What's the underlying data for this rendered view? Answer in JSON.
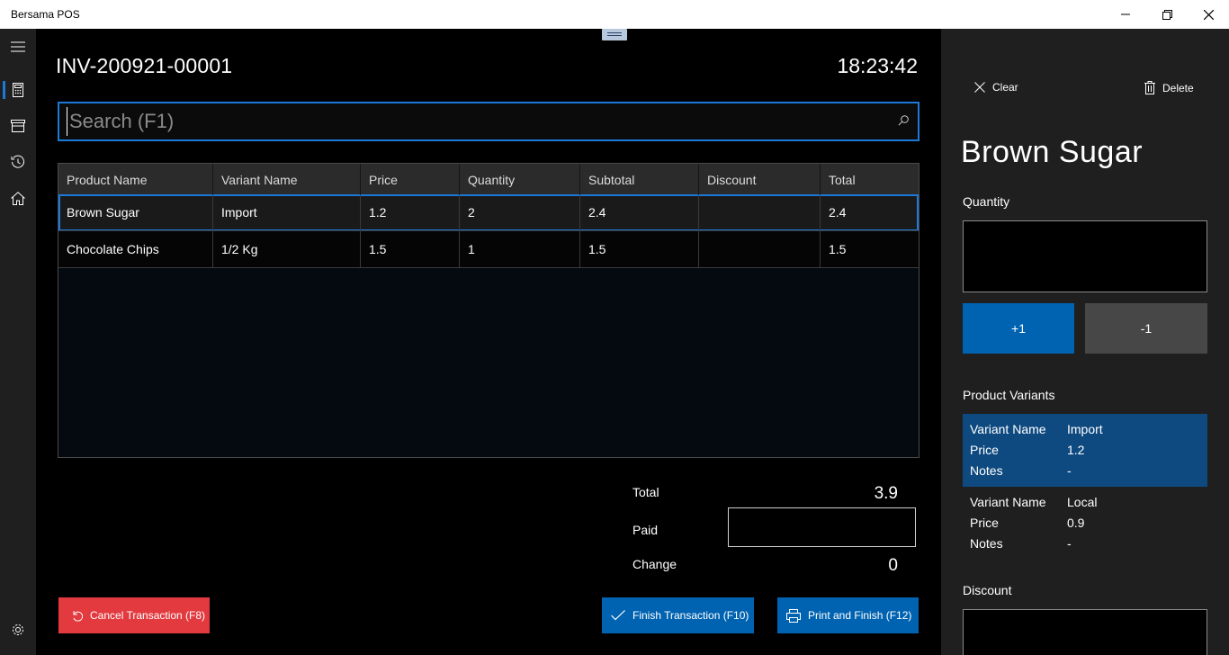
{
  "window": {
    "title": "Bersama POS"
  },
  "invoice": {
    "number": "INV-200921-00001",
    "time": "18:23:42"
  },
  "search": {
    "placeholder": "Search (F1)",
    "value": ""
  },
  "table": {
    "headers": [
      "Product Name",
      "Variant Name",
      "Price",
      "Quantity",
      "Subtotal",
      "Discount",
      "Total"
    ],
    "rows": [
      [
        "Brown Sugar",
        "Import",
        "1.2",
        "2",
        "2.4",
        "",
        "2.4"
      ],
      [
        "Chocolate Chips",
        "1/2 Kg",
        "1.5",
        "1",
        "1.5",
        "",
        "1.5"
      ]
    ]
  },
  "totals": {
    "total_label": "Total",
    "total_value": "3.9",
    "paid_label": "Paid",
    "paid_value": "",
    "change_label": "Change",
    "change_value": "0"
  },
  "actions": {
    "cancel": "Cancel Transaction (F8)",
    "finish": "Finish Transaction (F10)",
    "print": "Print and Finish (F12)"
  },
  "pane": {
    "clear": "Clear",
    "delete": "Delete",
    "product_name": "Brown Sugar",
    "quantity_label": "Quantity",
    "quantity_value": "",
    "plus": "+1",
    "minus": "-1",
    "variants_label": "Product Variants",
    "variants": [
      {
        "name_key": "Variant Name",
        "name": "Import",
        "price_key": "Price",
        "price": "1.2",
        "notes_key": "Notes",
        "notes": "-",
        "selected": true
      },
      {
        "name_key": "Variant Name",
        "name": "Local",
        "price_key": "Price",
        "price": "0.9",
        "notes_key": "Notes",
        "notes": "-",
        "selected": false
      }
    ],
    "discount_label": "Discount",
    "discount_value": ""
  },
  "colors": {
    "accent": "#0063b1",
    "focus": "#1e78d7",
    "danger": "#e23a3f",
    "selected_variant": "#0e4a80"
  }
}
